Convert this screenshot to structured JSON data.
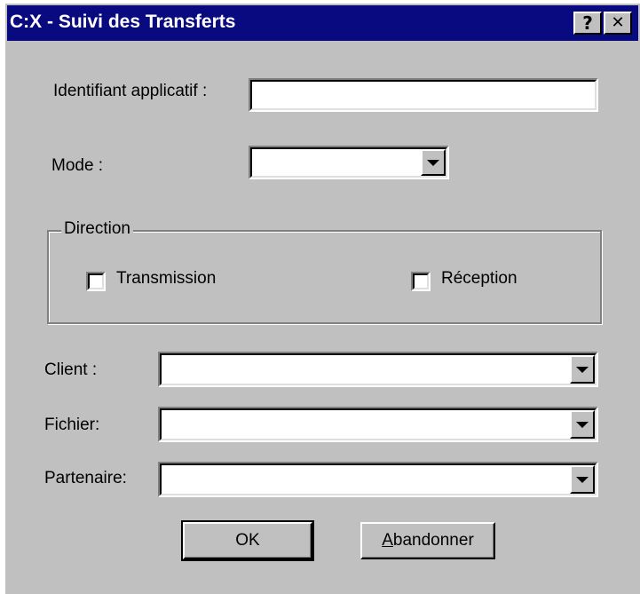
{
  "window": {
    "title": "C:X - Suivi des Transferts",
    "help_button": "?",
    "close_button": "✕"
  },
  "form": {
    "identifiant_label": "Identifiant applicatif :",
    "identifiant_value": "",
    "mode_label": "Mode :",
    "mode_value": "",
    "direction": {
      "legend": "Direction",
      "transmission_label": "Transmission",
      "transmission_checked": false,
      "reception_label": "Réception",
      "reception_checked": false
    },
    "client_label": "Client :",
    "client_value": "",
    "fichier_label": "Fichier:",
    "fichier_value": "",
    "partenaire_label": "Partenaire:",
    "partenaire_value": ""
  },
  "buttons": {
    "ok_label": "OK",
    "cancel_accel": "A",
    "cancel_rest": "bandonner"
  },
  "colors": {
    "titlebar": "#0a0a80",
    "face": "#c0c0c0"
  }
}
